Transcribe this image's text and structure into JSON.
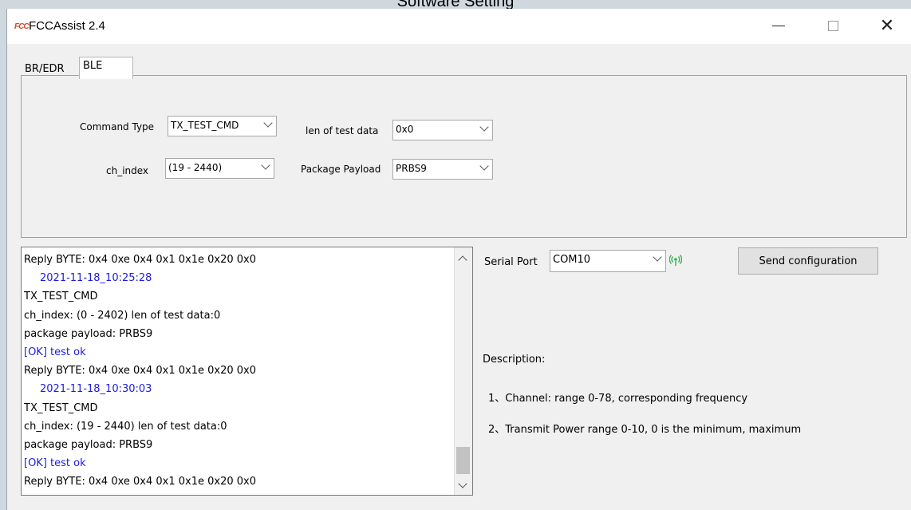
{
  "background_caption": "Software Setting",
  "window": {
    "title": "FCCAssist 2.4",
    "icon_text": "FCC"
  },
  "tabs": [
    {
      "label": "BR/EDR",
      "active": false
    },
    {
      "label": "BLE",
      "active": true
    }
  ],
  "panel": {
    "command_type": {
      "label": "Command Type",
      "value": "TX_TEST_CMD"
    },
    "ch_index": {
      "label": "ch_index",
      "value": "(19 - 2440)"
    },
    "len_of_test_data": {
      "label": "len of test data",
      "value": "0x0"
    },
    "package_payload": {
      "label": "Package Payload",
      "value": "PRBS9"
    }
  },
  "log": {
    "lines": [
      {
        "text": "Reply BYTE: 0x4 0xe 0x4 0x1 0x1e 0x20 0x0",
        "style": "normal"
      },
      {
        "text": "2021-11-18_10:25:28",
        "style": "timestamp"
      },
      {
        "text": "TX_TEST_CMD",
        "style": "normal"
      },
      {
        "text": "ch_index: (0 - 2402)  len of test data:0",
        "style": "normal"
      },
      {
        "text": "package payload: PRBS9",
        "style": "normal"
      },
      {
        "text": "[OK] test ok",
        "style": "ok"
      },
      {
        "text": "Reply BYTE: 0x4 0xe 0x4 0x1 0x1e 0x20 0x0",
        "style": "normal"
      },
      {
        "text": "2021-11-18_10:30:03",
        "style": "timestamp"
      },
      {
        "text": "TX_TEST_CMD",
        "style": "normal"
      },
      {
        "text": "ch_index: (19 - 2440)  len of test data:0",
        "style": "normal"
      },
      {
        "text": "package payload: PRBS9",
        "style": "normal"
      },
      {
        "text": "[OK] test ok",
        "style": "ok"
      },
      {
        "text": "Reply BYTE: 0x4 0xe 0x4 0x1 0x1e 0x20 0x0",
        "style": "normal"
      }
    ]
  },
  "serial": {
    "label": "Serial Port",
    "value": "COM10",
    "status_icon": "signal-connected-icon",
    "status_color": "#2fb84a"
  },
  "send_button": "Send configuration",
  "description": {
    "heading": "Description:",
    "items": [
      "1、Channel: range 0-78, corresponding frequency",
      "2、Transmit Power  range 0-10, 0 is the minimum, maximum"
    ]
  },
  "colors": {
    "log_blue": "#1c1ce0",
    "window_bg": "#f0f0f0"
  }
}
